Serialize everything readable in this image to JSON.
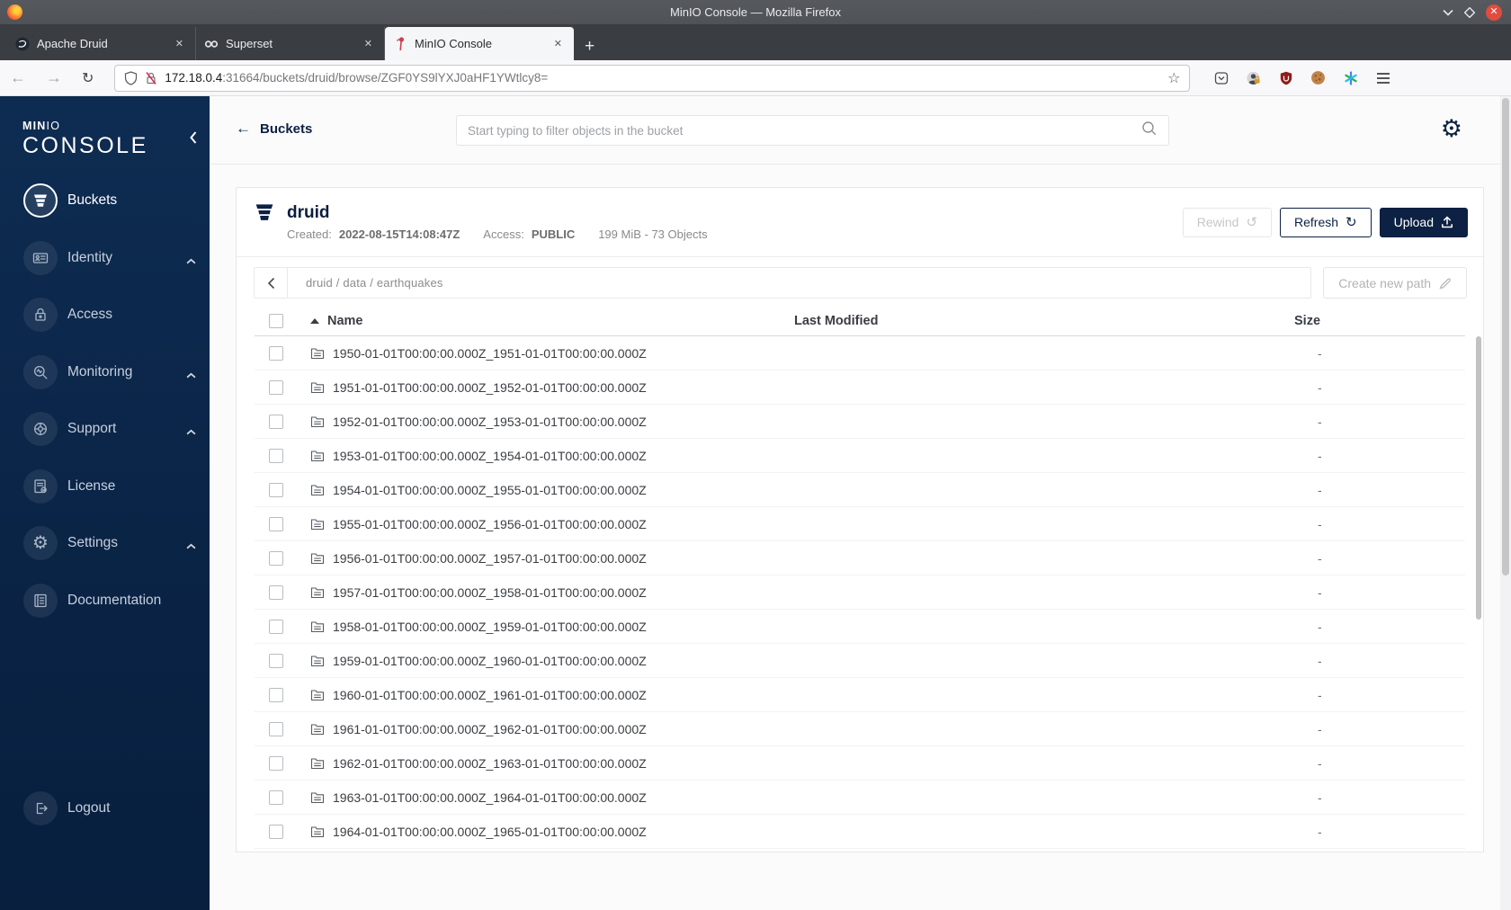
{
  "colors": {
    "accent": "#0c2143",
    "sidebar_top": "#0e2c52",
    "sidebar_bottom": "#081f3e",
    "upload_bg": "#0c2143",
    "close_button_red": "#e24b3f",
    "minio_logo_red": "#c7414f"
  },
  "icons": {
    "back_arrow": "←",
    "forward_arrow": "→",
    "reload": "↻",
    "star": "☆",
    "minio_back_arrow": "←",
    "gear": "⚙",
    "rewind": "↺",
    "refresh": "↻",
    "breadcrumb_chevron": "‹",
    "new_tab": "+",
    "tab_close": "✕",
    "size_dash": "-"
  },
  "titlebar": {
    "title": "MinIO Console — Mozilla Firefox"
  },
  "tabstrip": {
    "tabs": [
      {
        "label": "Apache Druid",
        "icon": "druid-logo",
        "active": false
      },
      {
        "label": "Superset",
        "icon": "superset-logo",
        "active": false
      },
      {
        "label": "MinIO Console",
        "icon": "minio-flamingo-logo",
        "active": true
      }
    ]
  },
  "navbar": {
    "url_host": "172.18.0.4",
    "url_rest": ":31664/buckets/druid/browse/ZGF0YS9lYXJ0aHF1YWtlcy8="
  },
  "sidebar": {
    "logo_min": "MIN",
    "logo_io": "IO",
    "logo_console": "CONSOLE",
    "items": [
      {
        "label": "Buckets",
        "active": true,
        "expandable": false
      },
      {
        "label": "Identity",
        "active": false,
        "expandable": true
      },
      {
        "label": "Access",
        "active": false,
        "expandable": false
      },
      {
        "label": "Monitoring",
        "active": false,
        "expandable": true
      },
      {
        "label": "Support",
        "active": false,
        "expandable": true
      },
      {
        "label": "License",
        "active": false,
        "expandable": false
      },
      {
        "label": "Settings",
        "active": false,
        "expandable": true
      },
      {
        "label": "Documentation",
        "active": false,
        "expandable": false
      }
    ],
    "logout_label": "Logout"
  },
  "topbar": {
    "back_label": "Buckets",
    "search_placeholder": "Start typing to filter objects in the bucket"
  },
  "bucket": {
    "name": "druid",
    "created_label": "Created:",
    "created_value": "2022-08-15T14:08:47Z",
    "access_label": "Access:",
    "access_value": "PUBLIC",
    "stats": "199 MiB - 73 Objects",
    "rewind_label": "Rewind",
    "refresh_label": "Refresh",
    "upload_label": "Upload"
  },
  "browse": {
    "breadcrumb": "druid / data / earthquakes",
    "create_path_label": "Create new path"
  },
  "table": {
    "name_header": "Name",
    "last_modified_header": "Last Modified",
    "size_header": "Size",
    "rows": [
      {
        "name": "1950-01-01T00:00:00.000Z_1951-01-01T00:00:00.000Z",
        "size": "-"
      },
      {
        "name": "1951-01-01T00:00:00.000Z_1952-01-01T00:00:00.000Z",
        "size": "-"
      },
      {
        "name": "1952-01-01T00:00:00.000Z_1953-01-01T00:00:00.000Z",
        "size": "-"
      },
      {
        "name": "1953-01-01T00:00:00.000Z_1954-01-01T00:00:00.000Z",
        "size": "-"
      },
      {
        "name": "1954-01-01T00:00:00.000Z_1955-01-01T00:00:00.000Z",
        "size": "-"
      },
      {
        "name": "1955-01-01T00:00:00.000Z_1956-01-01T00:00:00.000Z",
        "size": "-"
      },
      {
        "name": "1956-01-01T00:00:00.000Z_1957-01-01T00:00:00.000Z",
        "size": "-"
      },
      {
        "name": "1957-01-01T00:00:00.000Z_1958-01-01T00:00:00.000Z",
        "size": "-"
      },
      {
        "name": "1958-01-01T00:00:00.000Z_1959-01-01T00:00:00.000Z",
        "size": "-"
      },
      {
        "name": "1959-01-01T00:00:00.000Z_1960-01-01T00:00:00.000Z",
        "size": "-"
      },
      {
        "name": "1960-01-01T00:00:00.000Z_1961-01-01T00:00:00.000Z",
        "size": "-"
      },
      {
        "name": "1961-01-01T00:00:00.000Z_1962-01-01T00:00:00.000Z",
        "size": "-"
      },
      {
        "name": "1962-01-01T00:00:00.000Z_1963-01-01T00:00:00.000Z",
        "size": "-"
      },
      {
        "name": "1963-01-01T00:00:00.000Z_1964-01-01T00:00:00.000Z",
        "size": "-"
      },
      {
        "name": "1964-01-01T00:00:00.000Z_1965-01-01T00:00:00.000Z",
        "size": "-"
      }
    ]
  }
}
